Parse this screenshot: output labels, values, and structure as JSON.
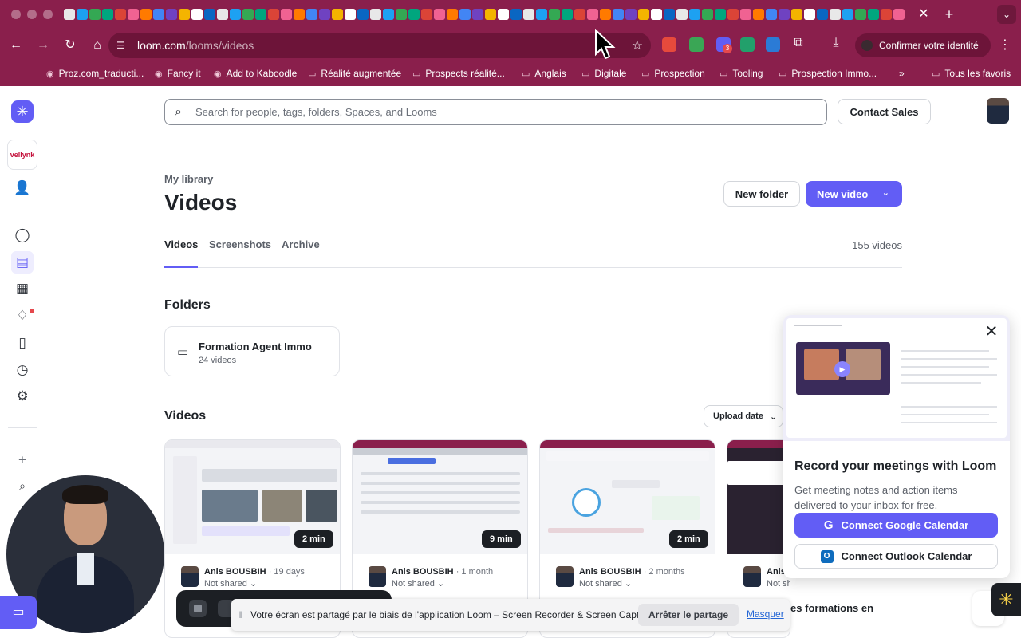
{
  "browser": {
    "tab_close": "✕",
    "tab_new": "+",
    "tab_menu": "⌄",
    "url_host": "loom.com",
    "url_path": "/looms/videos",
    "identity_label": "Confirmer votre identité",
    "ext_badge": "3",
    "bookmarks": [
      {
        "label": "Proz.com_traducti...",
        "icon": "globe-icon"
      },
      {
        "label": "Fancy it",
        "icon": "globe-icon"
      },
      {
        "label": "Add to Kaboodle",
        "icon": "globe-icon"
      },
      {
        "label": "Réalité augmentée",
        "icon": "folder-icon"
      },
      {
        "label": "Prospects réalité...",
        "icon": "folder-icon"
      },
      {
        "label": "Anglais",
        "icon": "folder-icon"
      },
      {
        "label": "Digitale",
        "icon": "folder-icon"
      },
      {
        "label": "Prospection",
        "icon": "folder-icon"
      },
      {
        "label": "Tooling",
        "icon": "folder-icon"
      },
      {
        "label": "Prospection Immo...",
        "icon": "folder-icon"
      }
    ],
    "bookmarks_more": "»",
    "all_bookmarks": "Tous les favoris",
    "colors": {
      "chrome": "#8a1f4c",
      "omnibox": "#6d1439"
    }
  },
  "app": {
    "accent": "#625df5",
    "workspace_label": "vellynk",
    "search": {
      "placeholder": "Search for people, tags, folders, Spaces, and Looms"
    },
    "contact_sales": "Contact Sales",
    "breadcrumb": "My library",
    "title": "Videos",
    "new_folder": "New folder",
    "new_video": "New video",
    "tabs": [
      {
        "label": "Videos",
        "active": true
      },
      {
        "label": "Screenshots",
        "active": false
      },
      {
        "label": "Archive",
        "active": false
      }
    ],
    "count": "155 videos",
    "folders_heading": "Folders",
    "folder": {
      "name": "Formation Agent Immo",
      "count": "24 videos"
    },
    "videos_heading": "Videos",
    "sort_label": "Upload date",
    "videos": [
      {
        "duration": "2 min",
        "author": "Anis BOUSBIH",
        "ago": "· 19 days",
        "sharing": "Not shared ⌄"
      },
      {
        "duration": "9 min",
        "author": "Anis BOUSBIH",
        "ago": "· 1 month",
        "sharing": "Not shared ⌄"
      },
      {
        "duration": "2 min",
        "author": "Anis BOUSBIH",
        "ago": "· 2 months",
        "sharing": "Not shared ⌄"
      },
      {
        "duration": "",
        "author": "Anis",
        "ago": "",
        "sharing": "Not shared ⌄"
      }
    ],
    "partial_title": "ion des formations en",
    "popup": {
      "title": "Record your meetings with Loom",
      "description": "Get meeting notes and action items delivered to your inbox for free.",
      "google_button": "Connect Google Calendar",
      "outlook_button": "Connect Outlook Calendar",
      "close": "✕"
    }
  },
  "screen_share": {
    "message": "Votre écran est partagé par le biais de l'application Loom – Screen Recorder & Screen Capture.",
    "stop_button": "Arrêter le partage",
    "hide_link": "Masquer"
  }
}
